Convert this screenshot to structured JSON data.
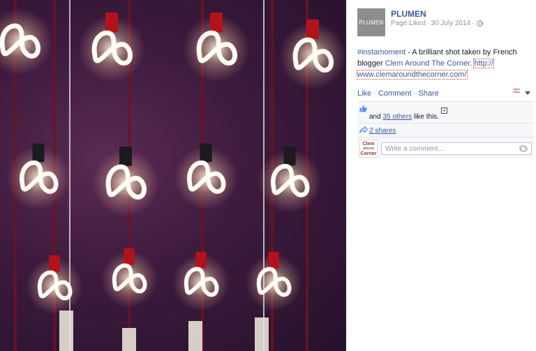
{
  "post": {
    "page_name": "PLUMEN",
    "logo_text": "PLUMEN",
    "liked_label": "Page Liked",
    "separator_dot": "·",
    "date": "30 July 2014",
    "hashtag": "#instamoment",
    "body_text": " - A brilliant shot taken by French blogger ",
    "blogger_link": "Clem Around The Corner",
    "period": ".",
    "url_line_1": "http://",
    "url_line_2": "www.clemaroundthecorner.com/"
  },
  "actions": {
    "like": "Like",
    "comment": "Comment",
    "share": "Share",
    "sep": " · ",
    "owner_thumb_text": "Clem Clem"
  },
  "feedback": {
    "likes_prefix": "and ",
    "likes_link": "35 others",
    "likes_suffix": " like this.",
    "expand_symbol": "+",
    "shares": "2 shares",
    "avatar_line1": "Clem",
    "avatar_line2": "around",
    "avatar_line3": "Corner",
    "comment_placeholder": "Write a comment..."
  },
  "colors": {
    "link": "#3b5998",
    "photo_bg": "#3c1a3d",
    "bulb_glow": "#fff6e6",
    "socket_red": "#b3121b"
  },
  "icons": [
    "globe-icon",
    "caret-icon",
    "thumb-icon",
    "expand-icon",
    "share-icon",
    "camera-icon"
  ]
}
